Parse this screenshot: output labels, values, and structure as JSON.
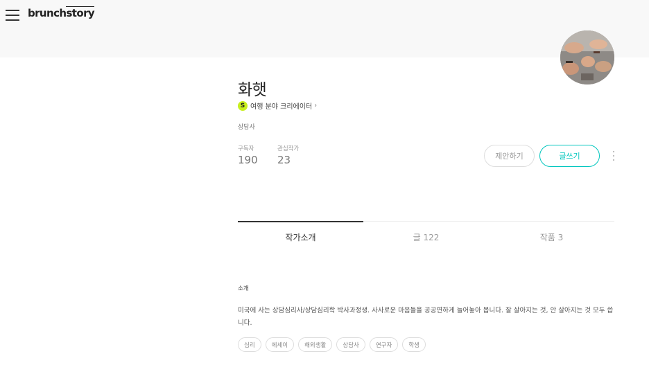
{
  "header": {
    "logo_brunch": "brunch",
    "logo_story": "story"
  },
  "author": {
    "name": "화햇",
    "creator_badge": "S",
    "creator_label": "여행 분야 크리에이터",
    "creator_chevron": "›",
    "job": "상담사"
  },
  "stats": {
    "subscribers_label": "구독자",
    "subscribers_value": "190",
    "following_label": "관심작가",
    "following_value": "23"
  },
  "actions": {
    "propose_label": "제안하기",
    "write_label": "글쓰기"
  },
  "tabs": [
    {
      "label": "작가소개"
    },
    {
      "label": "글 122"
    },
    {
      "label": "작품 3"
    }
  ],
  "intro": {
    "title": "소개",
    "text": "미국에 사는 상담심리사/상담심리학 박사과정생. 사사로운 마음들을 공공연하게 늘어놓아 봅니다. 잘 살아지는 것, 안 살아지는 것 모두 씁니다."
  },
  "tags": [
    "심리",
    "에세이",
    "해외생활",
    "상담사",
    "연구자",
    "학생"
  ],
  "colors": {
    "accent": "#00c6be",
    "badge": "#c8f01e",
    "header_bg": "#f8f8f8"
  }
}
